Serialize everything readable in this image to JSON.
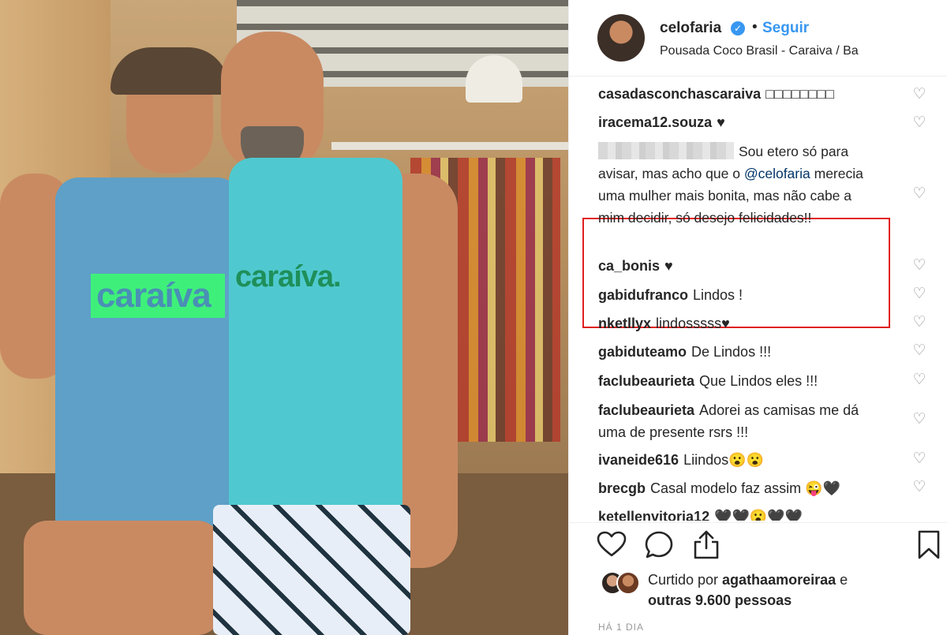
{
  "photo": {
    "shirt_text_left": "caraíva",
    "shirt_text_right": "caraíva."
  },
  "header": {
    "username": "celofaria",
    "verified_icon": "verified-badge-icon",
    "separator": "•",
    "follow_label": "Seguir",
    "location": "Pousada Coco Brasil - Caraiva / Ba"
  },
  "comments": [
    {
      "user": "casadasconchascaraiva",
      "text": "□□□□□□□□"
    },
    {
      "user": "iracema12.souza",
      "text": "♥"
    },
    {
      "user": "",
      "text_before": "Sou etero só para avisar, mas acho que o ",
      "mention": "@celofaria",
      "text_after": " merecia uma mulher mais bonita, mas não cabe a mim decidir, só desejo felicidades!!"
    },
    {
      "user": "ca_bonis",
      "text": "♥"
    },
    {
      "user": "gabidufranco",
      "text": "Lindos !"
    },
    {
      "user": "nketllyx",
      "text": "lindosssss♥"
    },
    {
      "user": "gabiduteamo",
      "text": "De Lindos !!!"
    },
    {
      "user": "faclubeaurieta",
      "text": "Que Lindos eles !!!"
    },
    {
      "user": "faclubeaurieta",
      "text": "Adorei as camisas me dá uma de presente rsrs !!!"
    },
    {
      "user": "ivaneide616",
      "text": "Liindos😮😮"
    },
    {
      "user": "brecgb",
      "text": "Casal modelo faz assim 😜🖤"
    },
    {
      "user": "ketellenvitoria12",
      "text": "🖤🖤😮🖤🖤"
    }
  ],
  "actions": {
    "like_icon": "heart-icon",
    "comment_icon": "comment-icon",
    "share_icon": "share-icon",
    "save_icon": "bookmark-icon"
  },
  "likes": {
    "prefix": "Curtido por ",
    "user": "agathaamoreiraa",
    "suffix": " e",
    "others": "outras 9.600 pessoas"
  },
  "timestamp": "HÁ 1 DIA"
}
